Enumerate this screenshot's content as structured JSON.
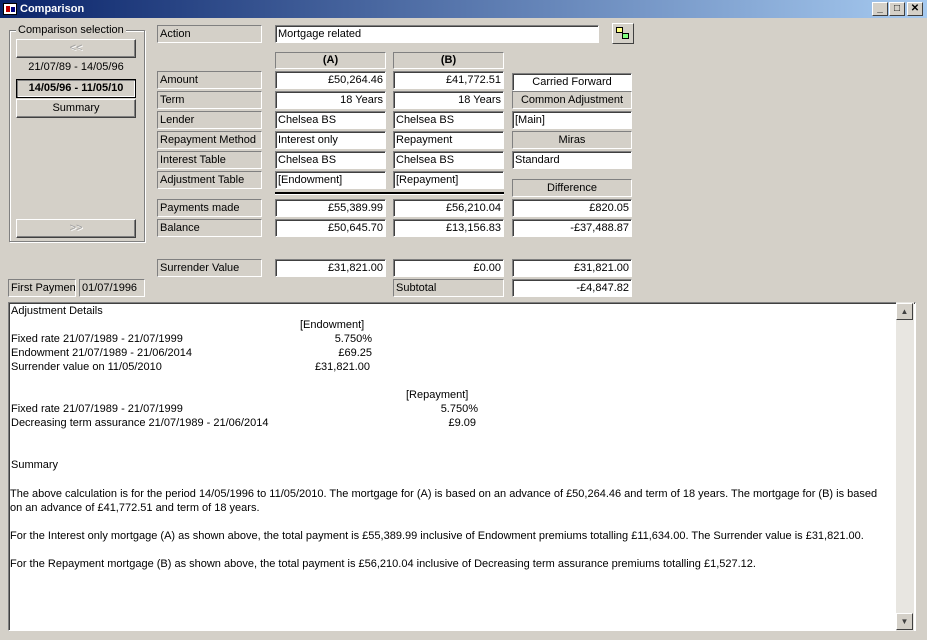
{
  "window": {
    "title": "Comparison"
  },
  "selection": {
    "legend": "Comparison selection",
    "prev": "<<",
    "next": ">>",
    "periods": [
      "21/07/89 - 14/05/96",
      "14/05/96 - 11/05/10"
    ],
    "summary": "Summary"
  },
  "action": {
    "label": "Action",
    "value": "Mortgage related"
  },
  "columns": {
    "a": "(A)",
    "b": "(B)"
  },
  "rows": [
    {
      "label": "Amount",
      "a": "£50,264.46",
      "b": "£41,772.51"
    },
    {
      "label": "Term",
      "a": "18 Years",
      "b": "18 Years"
    },
    {
      "label": "Lender",
      "a": "Chelsea BS",
      "b": "Chelsea BS"
    },
    {
      "label": "Repayment Method",
      "a": "Interest only",
      "b": "Repayment"
    },
    {
      "label": "Interest Table",
      "a": "Chelsea BS",
      "b": "Chelsea BS"
    },
    {
      "label": "Adjustment Table",
      "a": "[Endowment]",
      "b": "[Repayment]"
    }
  ],
  "right": {
    "carried_forward": "Carried Forward",
    "common_adjustment_label": "Common Adjustment",
    "common_adjustment_value": "[Main]",
    "miras_label": "Miras",
    "miras_value": "Standard",
    "difference_label": "Difference"
  },
  "results": [
    {
      "label": "Payments made",
      "a": "£55,389.99",
      "b": "£56,210.04",
      "diff": "£820.05"
    },
    {
      "label": "Balance",
      "a": "£50,645.70",
      "b": "£13,156.83",
      "diff": "-£37,488.87"
    }
  ],
  "surrender": {
    "label": "Surrender Value",
    "a": "£31,821.00",
    "b": "£0.00",
    "diff": "£31,821.00"
  },
  "subtotal": {
    "label": "Subtotal",
    "value": "-£4,847.82"
  },
  "first_payment": {
    "label": "First Payment",
    "value": "01/07/1996"
  },
  "details": {
    "heading": "Adjustment Details",
    "endowment_header": "[Endowment]",
    "endowment_lines": [
      {
        "desc": "Fixed rate 21/07/1989 - 21/07/1999",
        "val": "5.750%"
      },
      {
        "desc": "Endowment 21/07/1989 - 21/06/2014",
        "val": "£69.25"
      },
      {
        "desc": "Surrender value on 11/05/2010",
        "val": "£31,821.00"
      }
    ],
    "repayment_header": "[Repayment]",
    "repayment_lines": [
      {
        "desc": "Fixed rate 21/07/1989 - 21/07/1999",
        "val": "5.750%"
      },
      {
        "desc": "Decreasing term assurance 21/07/1989 - 21/06/2014",
        "val": "£9.09"
      }
    ],
    "summary_heading": "Summary",
    "summary_p1": "The above calculation is for the period 14/05/1996 to 11/05/2010. The mortgage for (A) is based on an advance of £50,264.46 and term of 18 years. The mortgage for (B) is based on an advance of £41,772.51 and term of 18 years.",
    "summary_p2": "For the Interest only mortgage (A) as shown above, the total payment is £55,389.99 inclusive of Endowment premiums totalling £11,634.00. The Surrender value is £31,821.00.",
    "summary_p3": "For the Repayment mortgage (B) as shown above, the total payment is £56,210.04 inclusive of Decreasing term assurance premiums totalling £1,527.12."
  }
}
